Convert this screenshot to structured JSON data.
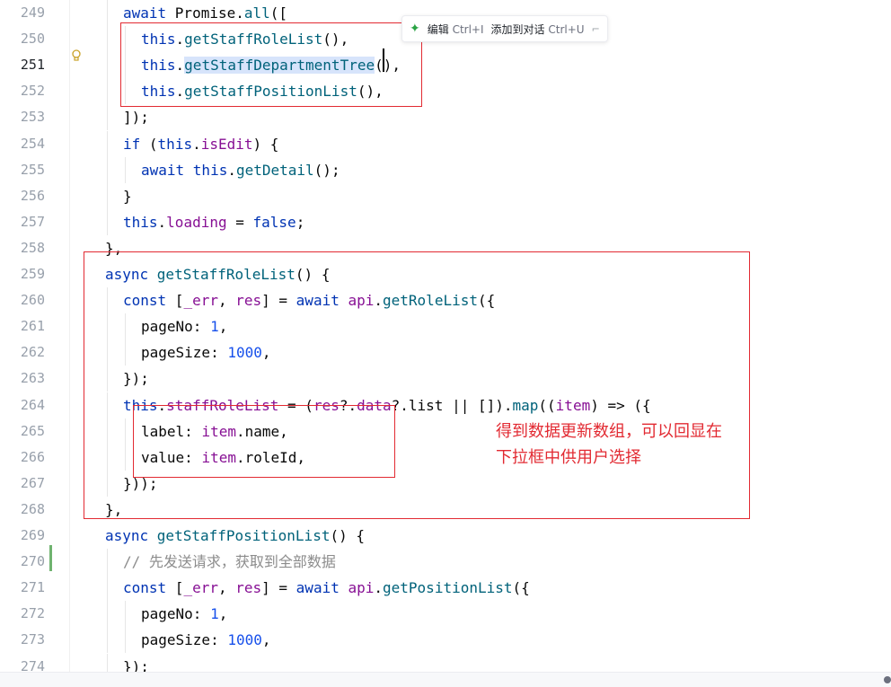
{
  "editor": {
    "lines": [
      {
        "num": "249",
        "indent": 2,
        "tokens": [
          {
            "t": "await ",
            "c": "kw"
          },
          {
            "t": "Promise",
            "c": "br"
          },
          {
            "t": ".",
            "c": "br"
          },
          {
            "t": "all",
            "c": "fn"
          },
          {
            "t": "([",
            "c": "br"
          }
        ]
      },
      {
        "num": "250",
        "indent": 3,
        "tokens": [
          {
            "t": "this",
            "c": "kw"
          },
          {
            "t": ".",
            "c": "br"
          },
          {
            "t": "getStaffRoleList",
            "c": "fn"
          },
          {
            "t": "(),",
            "c": "br"
          }
        ]
      },
      {
        "num": "251",
        "indent": 3,
        "current": true,
        "tokens": [
          {
            "t": "this",
            "c": "kw"
          },
          {
            "t": ".",
            "c": "br"
          },
          {
            "t": "getStaffDepartmentTree",
            "c": "fn hl"
          },
          {
            "t": "(),",
            "c": "br"
          }
        ]
      },
      {
        "num": "252",
        "indent": 3,
        "tokens": [
          {
            "t": "this",
            "c": "kw"
          },
          {
            "t": ".",
            "c": "br"
          },
          {
            "t": "getStaffPositionList",
            "c": "fn"
          },
          {
            "t": "(),",
            "c": "br"
          }
        ]
      },
      {
        "num": "253",
        "indent": 2,
        "tokens": [
          {
            "t": "]);",
            "c": "br"
          }
        ]
      },
      {
        "num": "254",
        "indent": 2,
        "tokens": [
          {
            "t": "if ",
            "c": "kw"
          },
          {
            "t": "(",
            "c": "br"
          },
          {
            "t": "this",
            "c": "kw"
          },
          {
            "t": ".",
            "c": "br"
          },
          {
            "t": "isEdit",
            "c": "pr"
          },
          {
            "t": ") {",
            "c": "br"
          }
        ]
      },
      {
        "num": "255",
        "indent": 3,
        "tokens": [
          {
            "t": "await ",
            "c": "kw"
          },
          {
            "t": "this",
            "c": "kw"
          },
          {
            "t": ".",
            "c": "br"
          },
          {
            "t": "getDetail",
            "c": "fn"
          },
          {
            "t": "();",
            "c": "br"
          }
        ]
      },
      {
        "num": "256",
        "indent": 2,
        "tokens": [
          {
            "t": "}",
            "c": "br"
          }
        ]
      },
      {
        "num": "257",
        "indent": 2,
        "tokens": [
          {
            "t": "this",
            "c": "kw"
          },
          {
            "t": ".",
            "c": "br"
          },
          {
            "t": "loading",
            "c": "pr"
          },
          {
            "t": " = ",
            "c": "br"
          },
          {
            "t": "false",
            "c": "kw"
          },
          {
            "t": ";",
            "c": "br"
          }
        ]
      },
      {
        "num": "258",
        "indent": 1,
        "tokens": [
          {
            "t": "},",
            "c": "br"
          }
        ]
      },
      {
        "num": "259",
        "indent": 1,
        "tokens": [
          {
            "t": "async ",
            "c": "kw"
          },
          {
            "t": "getStaffRoleList",
            "c": "fn"
          },
          {
            "t": "() {",
            "c": "br"
          }
        ]
      },
      {
        "num": "260",
        "indent": 2,
        "tokens": [
          {
            "t": "const ",
            "c": "kw"
          },
          {
            "t": "[",
            "c": "br"
          },
          {
            "t": "_err",
            "c": "pr"
          },
          {
            "t": ", ",
            "c": "br"
          },
          {
            "t": "res",
            "c": "pr"
          },
          {
            "t": "] = ",
            "c": "br"
          },
          {
            "t": "await ",
            "c": "kw"
          },
          {
            "t": "api",
            "c": "pr"
          },
          {
            "t": ".",
            "c": "br"
          },
          {
            "t": "getRoleList",
            "c": "fn"
          },
          {
            "t": "({",
            "c": "br"
          }
        ]
      },
      {
        "num": "261",
        "indent": 3,
        "tokens": [
          {
            "t": "pageNo",
            "c": "br"
          },
          {
            "t": ": ",
            "c": "br"
          },
          {
            "t": "1",
            "c": "nm"
          },
          {
            "t": ",",
            "c": "br"
          }
        ]
      },
      {
        "num": "262",
        "indent": 3,
        "tokens": [
          {
            "t": "pageSize",
            "c": "br"
          },
          {
            "t": ": ",
            "c": "br"
          },
          {
            "t": "1000",
            "c": "nm"
          },
          {
            "t": ",",
            "c": "br"
          }
        ]
      },
      {
        "num": "263",
        "indent": 2,
        "tokens": [
          {
            "t": "});",
            "c": "br"
          }
        ]
      },
      {
        "num": "264",
        "indent": 2,
        "tokens": [
          {
            "t": "this",
            "c": "kw"
          },
          {
            "t": ".",
            "c": "br"
          },
          {
            "t": "staffRoleList",
            "c": "pr"
          },
          {
            "t": " = (",
            "c": "br"
          },
          {
            "t": "res",
            "c": "pr"
          },
          {
            "t": "?.",
            "c": "br"
          },
          {
            "t": "data",
            "c": "pr"
          },
          {
            "t": "?.list || []).",
            "c": "br"
          },
          {
            "t": "map",
            "c": "fn"
          },
          {
            "t": "((",
            "c": "br"
          },
          {
            "t": "item",
            "c": "pr"
          },
          {
            "t": ") => ({",
            "c": "br"
          }
        ]
      },
      {
        "num": "265",
        "indent": 3,
        "tokens": [
          {
            "t": "label",
            "c": "br"
          },
          {
            "t": ": ",
            "c": "br"
          },
          {
            "t": "item",
            "c": "pr"
          },
          {
            "t": ".name,",
            "c": "br"
          }
        ]
      },
      {
        "num": "266",
        "indent": 3,
        "tokens": [
          {
            "t": "value",
            "c": "br"
          },
          {
            "t": ": ",
            "c": "br"
          },
          {
            "t": "item",
            "c": "pr"
          },
          {
            "t": ".roleId,",
            "c": "br"
          }
        ]
      },
      {
        "num": "267",
        "indent": 2,
        "tokens": [
          {
            "t": "}));",
            "c": "br"
          }
        ]
      },
      {
        "num": "268",
        "indent": 1,
        "tokens": [
          {
            "t": "},",
            "c": "br"
          }
        ]
      },
      {
        "num": "269",
        "indent": 1,
        "tokens": [
          {
            "t": "async ",
            "c": "kw"
          },
          {
            "t": "getStaffPositionList",
            "c": "fn"
          },
          {
            "t": "() {",
            "c": "br"
          }
        ]
      },
      {
        "num": "270",
        "indent": 2,
        "tokens": [
          {
            "t": "// 先发送请求，获取到全部数据",
            "c": "cm"
          }
        ]
      },
      {
        "num": "271",
        "indent": 2,
        "tokens": [
          {
            "t": "const ",
            "c": "kw"
          },
          {
            "t": "[",
            "c": "br"
          },
          {
            "t": "_err",
            "c": "pr"
          },
          {
            "t": ", ",
            "c": "br"
          },
          {
            "t": "res",
            "c": "pr"
          },
          {
            "t": "] = ",
            "c": "br"
          },
          {
            "t": "await ",
            "c": "kw"
          },
          {
            "t": "api",
            "c": "pr"
          },
          {
            "t": ".",
            "c": "br"
          },
          {
            "t": "getPositionList",
            "c": "fn"
          },
          {
            "t": "({",
            "c": "br"
          }
        ]
      },
      {
        "num": "272",
        "indent": 3,
        "tokens": [
          {
            "t": "pageNo",
            "c": "br"
          },
          {
            "t": ": ",
            "c": "br"
          },
          {
            "t": "1",
            "c": "nm"
          },
          {
            "t": ",",
            "c": "br"
          }
        ]
      },
      {
        "num": "273",
        "indent": 3,
        "tokens": [
          {
            "t": "pageSize",
            "c": "br"
          },
          {
            "t": ": ",
            "c": "br"
          },
          {
            "t": "1000",
            "c": "nm"
          },
          {
            "t": ",",
            "c": "br"
          }
        ]
      },
      {
        "num": "274",
        "indent": 2,
        "tokens": [
          {
            "t": "});",
            "c": "br"
          }
        ]
      }
    ]
  },
  "ai_toolbar": {
    "icon": "ai-sparkle-icon",
    "edit_label": "编辑",
    "edit_shortcut": "Ctrl+I",
    "add_label": "添加到对话",
    "add_shortcut": "Ctrl+U",
    "pin_icon": "pin-icon"
  },
  "annotation": {
    "line1": "得到数据更新数组，可以回显在",
    "line2": "下拉框中供用户选择"
  },
  "colors": {
    "keyword": "#0033b3",
    "function": "#00627a",
    "property": "#871094",
    "number": "#1750eb",
    "comment": "#8c8c8c",
    "annotation_red": "#e22a32"
  }
}
